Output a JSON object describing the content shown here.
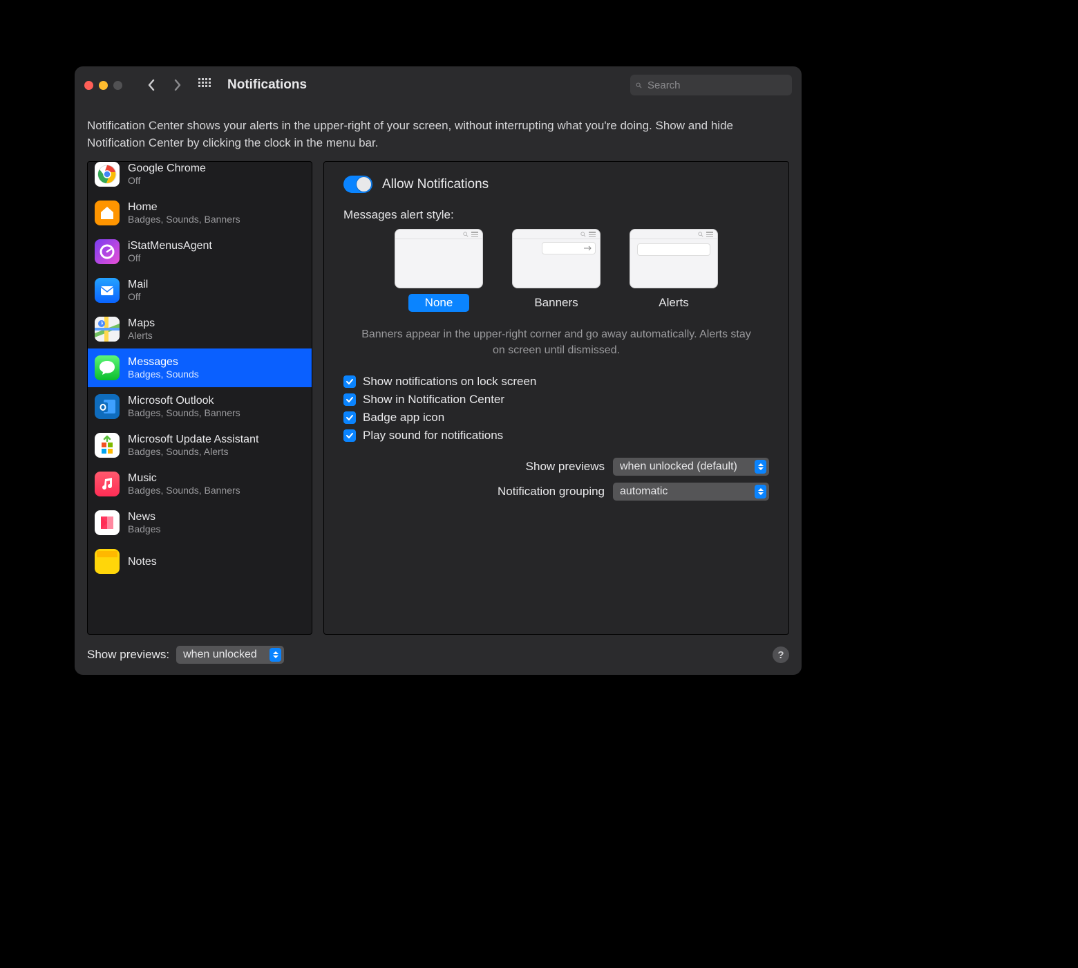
{
  "header": {
    "title": "Notifications",
    "search_placeholder": "Search"
  },
  "intro": "Notification Center shows your alerts in the upper-right of your screen, without interrupting what you're doing. Show and hide Notification Center by clicking the clock in the menu bar.",
  "sidebar": {
    "items": [
      {
        "name": "Google Chrome",
        "sub": "Off",
        "icon": "chrome",
        "bg": "#fff"
      },
      {
        "name": "Home",
        "sub": "Badges, Sounds, Banners",
        "icon": "home",
        "bg": "#ff9500"
      },
      {
        "name": "iStatMenusAgent",
        "sub": "Off",
        "icon": "istat",
        "bg": "linear-gradient(135deg,#7a3ef0,#e84fd6)"
      },
      {
        "name": "Mail",
        "sub": "Off",
        "icon": "mail",
        "bg": "linear-gradient(180deg,#24a2ff,#0a64ff)"
      },
      {
        "name": "Maps",
        "sub": "Alerts",
        "icon": "maps",
        "bg": "#f2f2f4"
      },
      {
        "name": "Messages",
        "sub": "Badges, Sounds",
        "icon": "messages",
        "bg": "linear-gradient(180deg,#5df777,#0bbd2c)",
        "selected": true
      },
      {
        "name": "Microsoft Outlook",
        "sub": "Badges, Sounds, Banners",
        "icon": "outlook",
        "bg": "#0f6cbd"
      },
      {
        "name": "Microsoft Update Assistant",
        "sub": "Badges, Sounds, Alerts",
        "icon": "msupdate",
        "bg": "#fff"
      },
      {
        "name": "Music",
        "sub": "Badges, Sounds, Banners",
        "icon": "music",
        "bg": "linear-gradient(180deg,#ff5a6e,#ff2d55)"
      },
      {
        "name": "News",
        "sub": "Badges",
        "icon": "news",
        "bg": "#fff"
      },
      {
        "name": "Notes",
        "sub": "",
        "icon": "notes",
        "bg": "#ffd60a"
      }
    ]
  },
  "details": {
    "allow_label": "Allow Notifications",
    "alert_style_label": "Messages alert style:",
    "styles": [
      {
        "label": "None",
        "selected": true,
        "kind": "none"
      },
      {
        "label": "Banners",
        "selected": false,
        "kind": "banner"
      },
      {
        "label": "Alerts",
        "selected": false,
        "kind": "alert"
      }
    ],
    "style_hint": "Banners appear in the upper-right corner and go away automatically. Alerts stay on screen until dismissed.",
    "checks": [
      {
        "label": "Show notifications on lock screen",
        "checked": true
      },
      {
        "label": "Show in Notification Center",
        "checked": true
      },
      {
        "label": "Badge app icon",
        "checked": true
      },
      {
        "label": "Play sound for notifications",
        "checked": true
      }
    ],
    "selects": [
      {
        "label": "Show previews",
        "value": "when unlocked (default)"
      },
      {
        "label": "Notification grouping",
        "value": "automatic"
      }
    ]
  },
  "footer": {
    "label": "Show previews:",
    "value": "when unlocked"
  }
}
